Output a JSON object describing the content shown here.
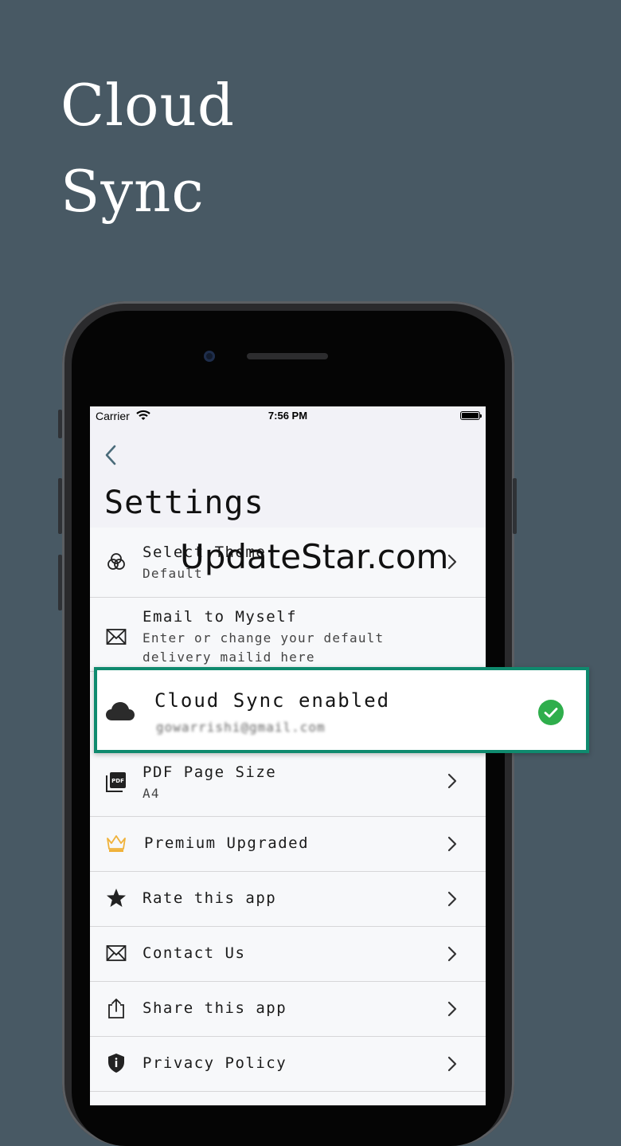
{
  "headline": {
    "line1": "Cloud",
    "line2": "Sync"
  },
  "status_bar": {
    "carrier": "Carrier",
    "time": "7:56 PM"
  },
  "nav": {
    "title": "Settings"
  },
  "watermark": "UpdateStar.com",
  "settings": [
    {
      "id": "theme",
      "title": "Select Theme",
      "subtitle": "Default",
      "icon": "theme-circles-icon"
    },
    {
      "id": "email",
      "title": "Email to Myself",
      "subtitle": "Enter or change your default delivery mailid here",
      "icon": "envelope-icon"
    },
    {
      "id": "cloud",
      "title": "Cloud Sync enabled",
      "subtitle": "gowarrishi@gmail.com",
      "icon": "cloud-icon",
      "status": "enabled-check-icon"
    },
    {
      "id": "pdf",
      "title": "PDF Page Size",
      "subtitle": "A4",
      "icon": "pdf-icon"
    },
    {
      "id": "premium",
      "title": "Premium Upgraded",
      "icon": "crown-icon"
    },
    {
      "id": "rate",
      "title": "Rate this app",
      "icon": "star-icon"
    },
    {
      "id": "contact",
      "title": "Contact Us",
      "icon": "envelope-icon"
    },
    {
      "id": "share",
      "title": "Share this app",
      "icon": "share-icon"
    },
    {
      "id": "privacy",
      "title": "Privacy Policy",
      "icon": "shield-icon"
    }
  ],
  "colors": {
    "background": "#485964",
    "accent_border": "#0f8a6e",
    "check_green": "#2fae4c",
    "back_chevron": "#4a6b7a",
    "crown": "#f0b23a"
  }
}
